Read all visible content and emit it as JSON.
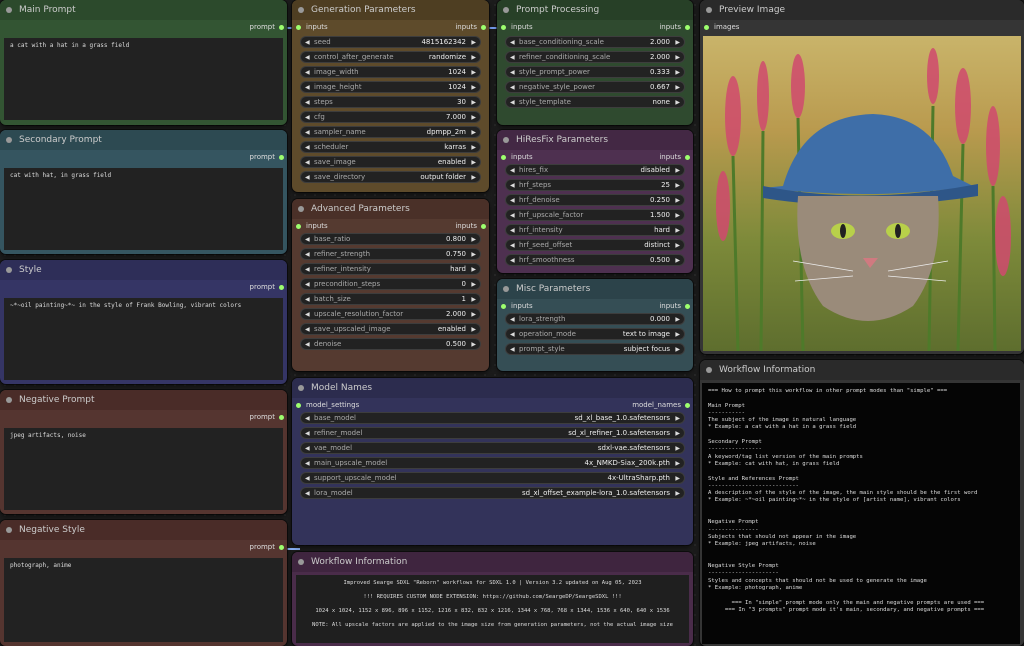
{
  "main_prompt": {
    "title": "Main Prompt",
    "output": "prompt",
    "text": "a cat with a hat in a grass field"
  },
  "secondary_prompt": {
    "title": "Secondary Prompt",
    "output": "prompt",
    "text": "cat with hat, in grass field"
  },
  "style": {
    "title": "Style",
    "output": "prompt",
    "text": "~*~oil painting~*~ in the style of Frank Bowling, vibrant colors"
  },
  "negative_prompt": {
    "title": "Negative Prompt",
    "output": "prompt",
    "text": "jpeg artifacts, noise"
  },
  "negative_style": {
    "title": "Negative Style",
    "output": "prompt",
    "text": "photograph, anime"
  },
  "generation": {
    "title": "Generation Parameters",
    "in": "inputs",
    "out": "inputs",
    "widgets": [
      {
        "k": "seed",
        "v": "4815162342"
      },
      {
        "k": "control_after_generate",
        "v": "randomize"
      },
      {
        "k": "image_width",
        "v": "1024"
      },
      {
        "k": "image_height",
        "v": "1024"
      },
      {
        "k": "steps",
        "v": "30"
      },
      {
        "k": "cfg",
        "v": "7.000"
      },
      {
        "k": "sampler_name",
        "v": "dpmpp_2m"
      },
      {
        "k": "scheduler",
        "v": "karras"
      },
      {
        "k": "save_image",
        "v": "enabled"
      },
      {
        "k": "save_directory",
        "v": "output folder"
      }
    ]
  },
  "advanced": {
    "title": "Advanced Parameters",
    "in": "inputs",
    "out": "inputs",
    "widgets": [
      {
        "k": "base_ratio",
        "v": "0.800"
      },
      {
        "k": "refiner_strength",
        "v": "0.750"
      },
      {
        "k": "refiner_intensity",
        "v": "hard"
      },
      {
        "k": "precondition_steps",
        "v": "0"
      },
      {
        "k": "batch_size",
        "v": "1"
      },
      {
        "k": "upscale_resolution_factor",
        "v": "2.000"
      },
      {
        "k": "save_upscaled_image",
        "v": "enabled"
      },
      {
        "k": "denoise",
        "v": "0.500"
      }
    ]
  },
  "prompt_processing": {
    "title": "Prompt Processing",
    "in": "inputs",
    "out": "inputs",
    "widgets": [
      {
        "k": "base_conditioning_scale",
        "v": "2.000"
      },
      {
        "k": "refiner_conditioning_scale",
        "v": "2.000"
      },
      {
        "k": "style_prompt_power",
        "v": "0.333"
      },
      {
        "k": "negative_style_power",
        "v": "0.667"
      },
      {
        "k": "style_template",
        "v": "none"
      }
    ]
  },
  "hiresfix": {
    "title": "HiResFix Parameters",
    "in": "inputs",
    "out": "inputs",
    "widgets": [
      {
        "k": "hires_fix",
        "v": "disabled"
      },
      {
        "k": "hrf_steps",
        "v": "25"
      },
      {
        "k": "hrf_denoise",
        "v": "0.250"
      },
      {
        "k": "hrf_upscale_factor",
        "v": "1.500"
      },
      {
        "k": "hrf_intensity",
        "v": "hard"
      },
      {
        "k": "hrf_seed_offset",
        "v": "distinct"
      },
      {
        "k": "hrf_smoothness",
        "v": "0.500"
      }
    ]
  },
  "misc": {
    "title": "Misc Parameters",
    "in": "inputs",
    "out": "inputs",
    "widgets": [
      {
        "k": "lora_strength",
        "v": "0.000"
      },
      {
        "k": "operation_mode",
        "v": "text to image"
      },
      {
        "k": "prompt_style",
        "v": "subject focus"
      }
    ]
  },
  "model_names": {
    "title": "Model Names",
    "in": "model_settings",
    "out": "model_names",
    "widgets": [
      {
        "k": "base_model",
        "v": "sd_xl_base_1.0.safetensors"
      },
      {
        "k": "refiner_model",
        "v": "sd_xl_refiner_1.0.safetensors"
      },
      {
        "k": "vae_model",
        "v": "sdxl-vae.safetensors"
      },
      {
        "k": "main_upscale_model",
        "v": "4x_NMKD-Siax_200k.pth"
      },
      {
        "k": "support_upscale_model",
        "v": "4x-UltraSharp.pth"
      },
      {
        "k": "lora_model",
        "v": "sd_xl_offset_example-lora_1.0.safetensors"
      }
    ]
  },
  "preview": {
    "title": "Preview Image",
    "input": "images"
  },
  "workflow_info_bottom": {
    "title": "Workflow Information",
    "lines": [
      "Improved Searge SDXL \"Reborn\" workflows for SDXL 1.0   |   Version 3.2 updated on Aug 05, 2023",
      "!!! REQUIRES CUSTOM NODE EXTENSION: https://github.com/SeargeDP/SeargeSDXL !!!",
      "1024 x 1024, 1152 x 896, 896 x 1152, 1216 x 832, 832 x 1216, 1344 x 768, 768 x 1344, 1536 x 640, 640 x 1536",
      "NOTE: All upscale factors are applied to the image size from generation parameters, not the actual image size"
    ]
  },
  "workflow_info_right": {
    "title": "Workflow Information",
    "text": "=== How to prompt this workflow in other prompt modes than \"simple\" ===\n\nMain Prompt\n-----------\nThe subject of the image in natural language\n* Example: a cat with a hat in a grass field\n\nSecondary Prompt\n----------------\nA keyword/tag list version of the main prompts\n* Example: cat with hat, in grass field\n\nStyle and References Prompt\n---------------------------\nA description of the style of the image, the main style should be the first word\n* Example: ~*~oil painting~*~ in the style of [artist name], vibrant colors\n\n\nNegative Prompt\n---------------\nSubjects that should not appear in the image\n* Example: jpeg artifacts, noise\n\n\nNegative Style Prompt\n---------------------\nStyles and concepts that should not be used to generate the image\n* Example: photograph, anime\n\n       === In \"simple\" prompt mode only the main and negative prompts are used ===\n     === In \"3 prompts\" prompt mode it's main, secondary, and negative prompts ==="
  },
  "colors": {
    "green": "#2a4a2a",
    "teal": "#2f4a52",
    "purple": "#2f2f55",
    "brown": "#4a2f2a",
    "olive": "#5a4a2a",
    "pin": "#9dff6e",
    "wire": "#7ea8ff"
  }
}
